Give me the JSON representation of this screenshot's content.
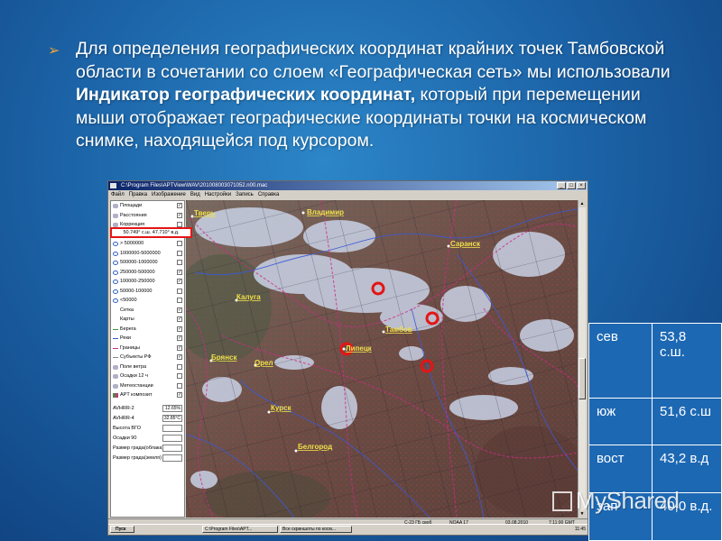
{
  "text_block": {
    "part1": "Для определения географических координат крайних точек Тамбовской области в сочетании со слоем «Географическая сеть» мы использовали ",
    "bold": "Индикатор географических координат,",
    "part2": " который при перемещении мыши отображает географические координаты точки на космическом снимке, находящейся под курсором."
  },
  "app": {
    "title": "C:\\Program Files\\APTView\\WAV\\201008003071052.n00.mac",
    "menu": [
      "Файл",
      "Правка",
      "Изображение",
      "Вид",
      "Настройки",
      "Запись",
      "Справка"
    ],
    "win_buttons": [
      "_",
      "□",
      "×"
    ],
    "coord_indicator": "50.749° с.ш.  47.710° в.д.",
    "layers": [
      {
        "label": "Площади",
        "checked": true
      },
      {
        "label": "Расстояния",
        "checked": true
      },
      {
        "label": "Коррекция",
        "checked": false
      },
      {
        "label": "Города",
        "checked": true
      },
      {
        "label": "> 5000000",
        "checked": false
      },
      {
        "label": "1000000-5000000",
        "checked": false
      },
      {
        "label": "500000-1000000",
        "checked": false
      },
      {
        "label": "250000-500000",
        "checked": true
      },
      {
        "label": "100000-250000",
        "checked": true
      },
      {
        "label": "50000-100000",
        "checked": false
      },
      {
        "label": "<50000",
        "checked": false
      },
      {
        "label": "Сетка",
        "checked": true
      },
      {
        "label": "Карты",
        "checked": true
      },
      {
        "label": "Берега",
        "checked": true
      },
      {
        "label": "Реки",
        "checked": true
      },
      {
        "label": "Границы",
        "checked": true
      },
      {
        "label": "Субъекты РФ",
        "checked": true
      },
      {
        "label": "Поле ветра",
        "checked": false
      },
      {
        "label": "Осадки 12 ч",
        "checked": false
      },
      {
        "label": "Метеостанции",
        "checked": false
      },
      {
        "label": "APT композит",
        "checked": true
      }
    ],
    "fields": [
      {
        "label": "AVHRR-2",
        "value": "12.65%"
      },
      {
        "label": "AVHRR-4",
        "value": "32.85°C"
      },
      {
        "label": "Высота ВГО",
        "value": ""
      },
      {
        "label": "Осадки 90",
        "value": ""
      },
      {
        "label": "Размер града(облака)",
        "value": ""
      },
      {
        "label": "Размер града(земля)",
        "value": ""
      }
    ],
    "cities": [
      "Тверь",
      "Владимир",
      "Саранск",
      "Калуга",
      "Тамбов",
      "Липецк",
      "Брянск",
      "Орел",
      "Курск",
      "Белгород"
    ],
    "status": {
      "left": "",
      "mid1": "С-23 ГБ своб",
      "mid2": "NOAA 17",
      "date": "03.08.2010",
      "time": "7:11:00 GMT"
    },
    "taskbar": {
      "start": "Пуск",
      "tasks": [
        "C:\\Program Files\\APT...",
        "Все скриншоты по косм..."
      ],
      "clock": "11:45"
    }
  },
  "coords": [
    {
      "dir": "сев",
      "value": "53,8 с.ш."
    },
    {
      "dir": "юж",
      "value": "51,6 с.ш"
    },
    {
      "dir": "вост",
      "value": "43,2 в.д"
    },
    {
      "dir": "зап",
      "value": "40,0 в.д."
    }
  ],
  "watermark": "MyShared",
  "colors": {
    "background": "#1c64a8",
    "highlight_red": "#e41515",
    "bullet": "#e8a23c"
  }
}
